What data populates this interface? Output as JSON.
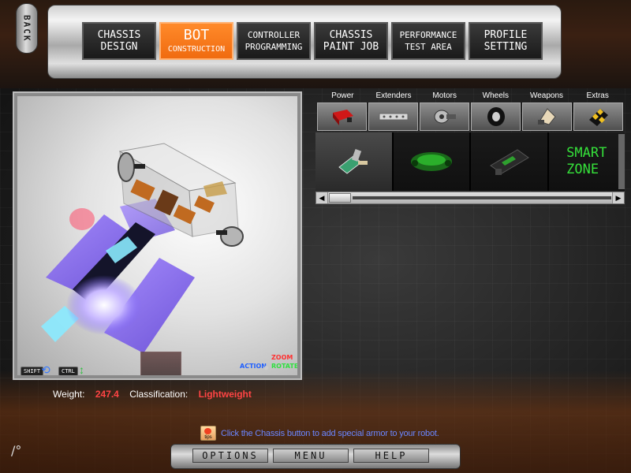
{
  "back": {
    "label": "BACK"
  },
  "nav": {
    "tabs": [
      {
        "line1": "CHASSIS",
        "line2": "DESIGN",
        "active": false,
        "small": false
      },
      {
        "line1": "BOT",
        "line2": "CONSTRUCTION",
        "active": true,
        "small": false
      },
      {
        "line1": "CONTROLLER",
        "line2": "PROGRAMMING",
        "active": false,
        "small": true
      },
      {
        "line1": "CHASSIS",
        "line2": "PAINT JOB",
        "active": false,
        "small": false
      },
      {
        "line1": "PERFORMANCE",
        "line2": "TEST AREA",
        "active": false,
        "small": true
      },
      {
        "line1": "PROFILE",
        "line2": "SETTING",
        "active": false,
        "small": false
      }
    ]
  },
  "viewport": {
    "shift_label": "SHIFT",
    "ctrl_label": "CTRL",
    "action_label": "ACTION",
    "zoom_label": "ZOOM",
    "rotate_label": "ROTATE"
  },
  "stats": {
    "weight_label": "Weight:",
    "weight_value": "247.4",
    "class_label": "Classification:",
    "class_value": "Lightweight"
  },
  "parts_panel": {
    "categories": [
      "Power",
      "Extenders",
      "Motors",
      "Wheels",
      "Weapons",
      "Extras"
    ],
    "category_icons": [
      "battery-icon",
      "extender-bar-icon",
      "motor-icon",
      "wheel-icon",
      "weapon-icon",
      "hazard-extras-icon"
    ],
    "smart_zone": {
      "line1": "SMART",
      "line2": "ZONE"
    }
  },
  "tip": {
    "icon_label": "tips",
    "text": "Click the Chassis button to add special armor to your robot."
  },
  "bottom_menu": {
    "options": "OPTIONS",
    "menu": "MENU",
    "help": "HELP"
  },
  "colors": {
    "accent_orange": "#f06b10",
    "weight_red": "#ff4444",
    "smart_green": "#35e03a",
    "tip_blue": "#6a86ff",
    "zoom_red": "#ff3030",
    "rotate_green": "#30e040",
    "action_blue": "#2060ff"
  }
}
